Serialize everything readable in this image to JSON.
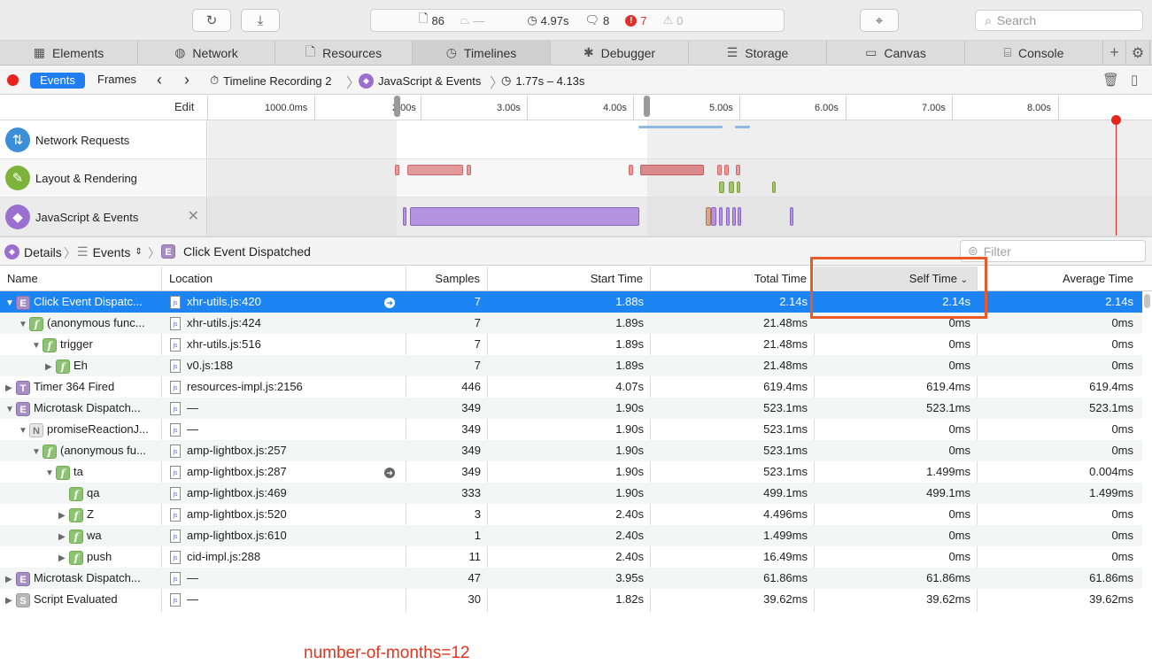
{
  "toolbar": {
    "resources_count": "86",
    "resources_icon": "document-icon",
    "weight_value": "—",
    "time_value": "4.97s",
    "logs_count": "8",
    "errors_count": "7",
    "warnings_count": "0",
    "search_placeholder": "Search"
  },
  "tabs": [
    {
      "label": "Elements",
      "icon": "elements-icon"
    },
    {
      "label": "Network",
      "icon": "network-icon"
    },
    {
      "label": "Resources",
      "icon": "resources-icon"
    },
    {
      "label": "Timelines",
      "icon": "timelines-icon"
    },
    {
      "label": "Debugger",
      "icon": "debugger-icon"
    },
    {
      "label": "Storage",
      "icon": "storage-icon"
    },
    {
      "label": "Canvas",
      "icon": "canvas-icon"
    },
    {
      "label": "Console",
      "icon": "console-icon"
    }
  ],
  "navbar": {
    "events_label": "Events",
    "frames_label": "Frames",
    "recording": "Timeline Recording 2",
    "track": "JavaScript & Events",
    "range": "1.77s – 4.13s"
  },
  "ruler": {
    "edit_label": "Edit",
    "ticks": [
      "1000.0ms",
      "2.00s",
      "3.00s",
      "4.00s",
      "5.00s",
      "6.00s",
      "7.00s",
      "8.00s"
    ]
  },
  "tracks": [
    {
      "name": "Network Requests",
      "icon": "network-requests-icon",
      "color": "#3b8ed8"
    },
    {
      "name": "Layout & Rendering",
      "icon": "brush-icon",
      "color": "#7db33a"
    },
    {
      "name": "JavaScript & Events",
      "icon": "script-icon",
      "color": "#9a6fd0"
    }
  ],
  "details": {
    "details_label": "Details",
    "events_label": "Events",
    "crumb": "Click Event Dispatched",
    "filter_placeholder": "Filter"
  },
  "columns": [
    "Name",
    "Location",
    "Samples",
    "Start Time",
    "Total Time",
    "Self Time",
    "Average Time"
  ],
  "rows": [
    {
      "name": "Click Event Dispatc...",
      "badge": "E",
      "indent": 0,
      "tri": "down",
      "location": "xhr-utils.js:420",
      "go": true,
      "samples": "7",
      "start": "1.88s",
      "total": "2.14s",
      "self": "2.14s",
      "avg": "2.14s"
    },
    {
      "name": "(anonymous func...",
      "badge": "f",
      "indent": 1,
      "tri": "down",
      "location": "xhr-utils.js:424",
      "go": false,
      "samples": "7",
      "start": "1.89s",
      "total": "21.48ms",
      "self": "0ms",
      "avg": "0ms"
    },
    {
      "name": "trigger",
      "badge": "f",
      "indent": 2,
      "tri": "down",
      "location": "xhr-utils.js:516",
      "go": false,
      "samples": "7",
      "start": "1.89s",
      "total": "21.48ms",
      "self": "0ms",
      "avg": "0ms"
    },
    {
      "name": "Eh",
      "badge": "f",
      "indent": 3,
      "tri": "right",
      "location": "v0.js:188",
      "go": false,
      "samples": "7",
      "start": "1.89s",
      "total": "21.48ms",
      "self": "0ms",
      "avg": "0ms"
    },
    {
      "name": "Timer 364 Fired",
      "badge": "T",
      "indent": 0,
      "tri": "right",
      "location": "resources-impl.js:2156",
      "go": false,
      "samples": "446",
      "start": "4.07s",
      "total": "619.4ms",
      "self": "619.4ms",
      "avg": "619.4ms"
    },
    {
      "name": "Microtask Dispatch...",
      "badge": "E",
      "indent": 0,
      "tri": "down",
      "location": "—",
      "go": false,
      "samples": "349",
      "start": "1.90s",
      "total": "523.1ms",
      "self": "523.1ms",
      "avg": "523.1ms"
    },
    {
      "name": "promiseReactionJ...",
      "badge": "N",
      "indent": 1,
      "tri": "down",
      "location": "—",
      "go": false,
      "samples": "349",
      "start": "1.90s",
      "total": "523.1ms",
      "self": "0ms",
      "avg": "0ms"
    },
    {
      "name": "(anonymous fu...",
      "badge": "f",
      "indent": 2,
      "tri": "down",
      "location": "amp-lightbox.js:257",
      "go": false,
      "samples": "349",
      "start": "1.90s",
      "total": "523.1ms",
      "self": "0ms",
      "avg": "0ms"
    },
    {
      "name": "ta",
      "badge": "f",
      "indent": 3,
      "tri": "down",
      "location": "amp-lightbox.js:287",
      "go": true,
      "samples": "349",
      "start": "1.90s",
      "total": "523.1ms",
      "self": "1.499ms",
      "avg": "0.004ms"
    },
    {
      "name": "qa",
      "badge": "f",
      "indent": 4,
      "tri": "none",
      "location": "amp-lightbox.js:469",
      "go": false,
      "samples": "333",
      "start": "1.90s",
      "total": "499.1ms",
      "self": "499.1ms",
      "avg": "1.499ms"
    },
    {
      "name": "Z",
      "badge": "f",
      "indent": 4,
      "tri": "right",
      "location": "amp-lightbox.js:520",
      "go": false,
      "samples": "3",
      "start": "2.40s",
      "total": "4.496ms",
      "self": "0ms",
      "avg": "0ms"
    },
    {
      "name": "wa",
      "badge": "f",
      "indent": 4,
      "tri": "right",
      "location": "amp-lightbox.js:610",
      "go": false,
      "samples": "1",
      "start": "2.40s",
      "total": "1.499ms",
      "self": "0ms",
      "avg": "0ms"
    },
    {
      "name": "push",
      "badge": "f",
      "indent": 4,
      "tri": "right",
      "location": "cid-impl.js:288",
      "go": false,
      "samples": "11",
      "start": "2.40s",
      "total": "16.49ms",
      "self": "0ms",
      "avg": "0ms"
    },
    {
      "name": "Microtask Dispatch...",
      "badge": "E",
      "indent": 0,
      "tri": "right",
      "location": "—",
      "go": false,
      "samples": "47",
      "start": "3.95s",
      "total": "61.86ms",
      "self": "61.86ms",
      "avg": "61.86ms"
    },
    {
      "name": "Script Evaluated",
      "badge": "S",
      "indent": 0,
      "tri": "right",
      "location": "—",
      "go": false,
      "samples": "30",
      "start": "1.82s",
      "total": "39.62ms",
      "self": "39.62ms",
      "avg": "39.62ms"
    }
  ],
  "caption": "number-of-months=12"
}
